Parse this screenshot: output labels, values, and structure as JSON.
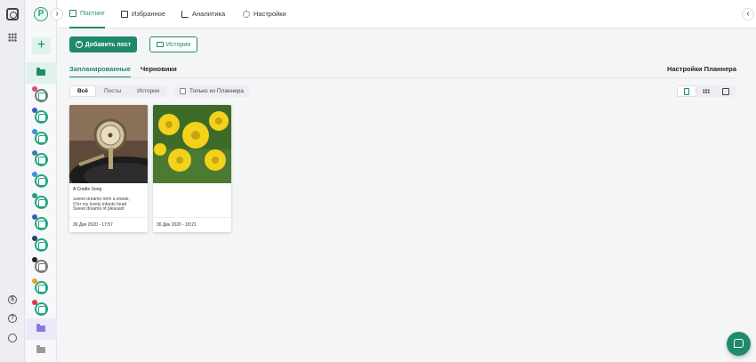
{
  "topnav": {
    "tabs": [
      {
        "label": "Постинг",
        "icon": "calendar-icon"
      },
      {
        "label": "Избранное",
        "icon": "bookmark-icon"
      },
      {
        "label": "Аналитика",
        "icon": "chart-icon"
      },
      {
        "label": "Настройки",
        "icon": "gear-icon"
      }
    ]
  },
  "sidebar": {
    "brand_letter": "P",
    "add_label": "+",
    "collapse_glyph": "›",
    "expand_glyph": "‹"
  },
  "actions": {
    "add_post": "Добавить пост",
    "stories": "Истории"
  },
  "subtabs": {
    "scheduled": "Запланированные",
    "drafts": "Черновики",
    "planner_settings": "Настройки Планнера"
  },
  "filters": {
    "all": "Всё",
    "posts": "Посты",
    "stories": "Истории",
    "only_planner": "Только из Планнера"
  },
  "posts": [
    {
      "title": "A Cradle Song",
      "body": "Sweet dreams form a shade,\nO'er my lovely infants head\nSweet dreams of pleasant",
      "date": "30 Дек 2020 - 17:57"
    },
    {
      "title": "",
      "body": "",
      "date": "30 Дек 2020 - 18:21"
    }
  ],
  "colors": {
    "accent": "#1f8a6a",
    "accent_light": "#dff3ec"
  }
}
